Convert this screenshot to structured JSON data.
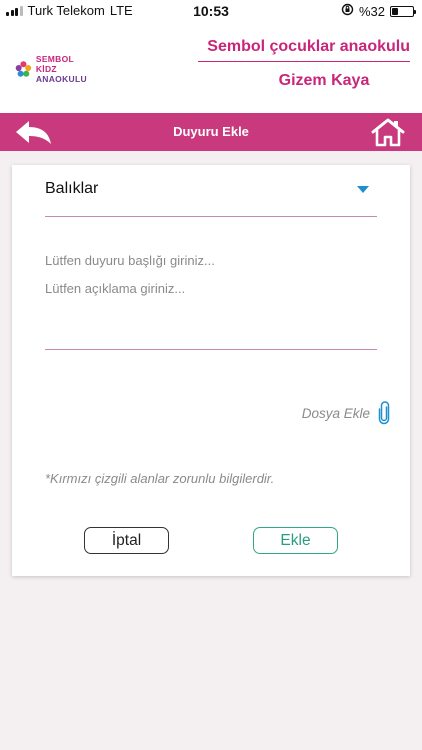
{
  "status_bar": {
    "carrier": "Turk Telekom",
    "network": "LTE",
    "time": "10:53",
    "battery": "%32",
    "battery_level": 0.32
  },
  "header": {
    "logo_line1": "SEMBOL KİDZ",
    "logo_line2": "ANAOKULU",
    "school_name": "Sembol çocuklar anaokulu",
    "user_name": "Gizem Kaya"
  },
  "titlebar": {
    "title": "Duyuru Ekle",
    "back_icon": "back-arrow-icon",
    "home_icon": "home-icon"
  },
  "form": {
    "group_selected": "Balıklar",
    "title_placeholder": "Lütfen duyuru başlığı giriniz...",
    "title_value": "",
    "description_placeholder": "Lütfen açıklama giriniz...",
    "description_value": "",
    "attach_label": "Dosya Ekle",
    "required_note": "*Kırmızı çizgili alanlar zorunlu bilgilerdir.",
    "cancel_label": "İptal",
    "add_label": "Ekle"
  },
  "colors": {
    "brand_pink": "#c8397e",
    "accent_green": "#2fa88a",
    "caret_blue": "#1f8fd0"
  }
}
